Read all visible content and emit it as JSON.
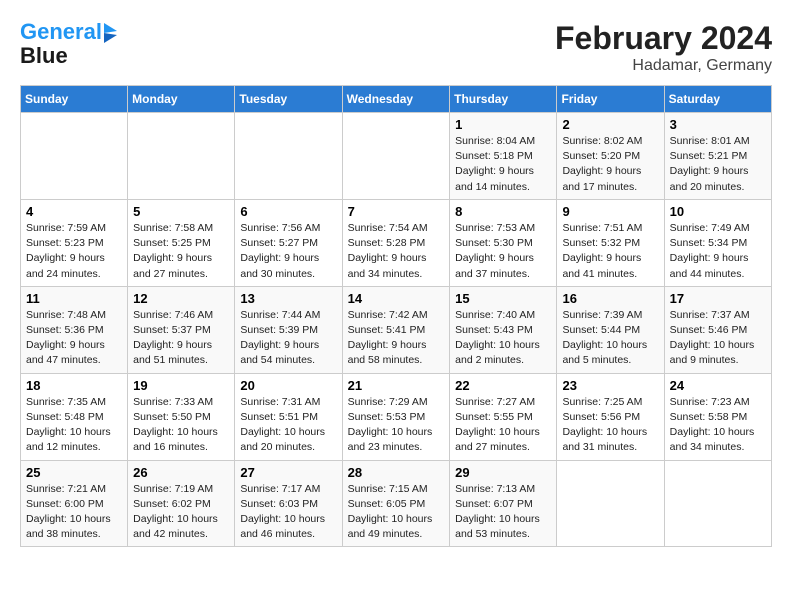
{
  "logo": {
    "line1": "General",
    "line2": "Blue"
  },
  "title": {
    "month_year": "February 2024",
    "location": "Hadamar, Germany"
  },
  "headers": [
    "Sunday",
    "Monday",
    "Tuesday",
    "Wednesday",
    "Thursday",
    "Friday",
    "Saturday"
  ],
  "weeks": [
    [
      {
        "day": "",
        "info": ""
      },
      {
        "day": "",
        "info": ""
      },
      {
        "day": "",
        "info": ""
      },
      {
        "day": "",
        "info": ""
      },
      {
        "day": "1",
        "info": "Sunrise: 8:04 AM\nSunset: 5:18 PM\nDaylight: 9 hours\nand 14 minutes."
      },
      {
        "day": "2",
        "info": "Sunrise: 8:02 AM\nSunset: 5:20 PM\nDaylight: 9 hours\nand 17 minutes."
      },
      {
        "day": "3",
        "info": "Sunrise: 8:01 AM\nSunset: 5:21 PM\nDaylight: 9 hours\nand 20 minutes."
      }
    ],
    [
      {
        "day": "4",
        "info": "Sunrise: 7:59 AM\nSunset: 5:23 PM\nDaylight: 9 hours\nand 24 minutes."
      },
      {
        "day": "5",
        "info": "Sunrise: 7:58 AM\nSunset: 5:25 PM\nDaylight: 9 hours\nand 27 minutes."
      },
      {
        "day": "6",
        "info": "Sunrise: 7:56 AM\nSunset: 5:27 PM\nDaylight: 9 hours\nand 30 minutes."
      },
      {
        "day": "7",
        "info": "Sunrise: 7:54 AM\nSunset: 5:28 PM\nDaylight: 9 hours\nand 34 minutes."
      },
      {
        "day": "8",
        "info": "Sunrise: 7:53 AM\nSunset: 5:30 PM\nDaylight: 9 hours\nand 37 minutes."
      },
      {
        "day": "9",
        "info": "Sunrise: 7:51 AM\nSunset: 5:32 PM\nDaylight: 9 hours\nand 41 minutes."
      },
      {
        "day": "10",
        "info": "Sunrise: 7:49 AM\nSunset: 5:34 PM\nDaylight: 9 hours\nand 44 minutes."
      }
    ],
    [
      {
        "day": "11",
        "info": "Sunrise: 7:48 AM\nSunset: 5:36 PM\nDaylight: 9 hours\nand 47 minutes."
      },
      {
        "day": "12",
        "info": "Sunrise: 7:46 AM\nSunset: 5:37 PM\nDaylight: 9 hours\nand 51 minutes."
      },
      {
        "day": "13",
        "info": "Sunrise: 7:44 AM\nSunset: 5:39 PM\nDaylight: 9 hours\nand 54 minutes."
      },
      {
        "day": "14",
        "info": "Sunrise: 7:42 AM\nSunset: 5:41 PM\nDaylight: 9 hours\nand 58 minutes."
      },
      {
        "day": "15",
        "info": "Sunrise: 7:40 AM\nSunset: 5:43 PM\nDaylight: 10 hours\nand 2 minutes."
      },
      {
        "day": "16",
        "info": "Sunrise: 7:39 AM\nSunset: 5:44 PM\nDaylight: 10 hours\nand 5 minutes."
      },
      {
        "day": "17",
        "info": "Sunrise: 7:37 AM\nSunset: 5:46 PM\nDaylight: 10 hours\nand 9 minutes."
      }
    ],
    [
      {
        "day": "18",
        "info": "Sunrise: 7:35 AM\nSunset: 5:48 PM\nDaylight: 10 hours\nand 12 minutes."
      },
      {
        "day": "19",
        "info": "Sunrise: 7:33 AM\nSunset: 5:50 PM\nDaylight: 10 hours\nand 16 minutes."
      },
      {
        "day": "20",
        "info": "Sunrise: 7:31 AM\nSunset: 5:51 PM\nDaylight: 10 hours\nand 20 minutes."
      },
      {
        "day": "21",
        "info": "Sunrise: 7:29 AM\nSunset: 5:53 PM\nDaylight: 10 hours\nand 23 minutes."
      },
      {
        "day": "22",
        "info": "Sunrise: 7:27 AM\nSunset: 5:55 PM\nDaylight: 10 hours\nand 27 minutes."
      },
      {
        "day": "23",
        "info": "Sunrise: 7:25 AM\nSunset: 5:56 PM\nDaylight: 10 hours\nand 31 minutes."
      },
      {
        "day": "24",
        "info": "Sunrise: 7:23 AM\nSunset: 5:58 PM\nDaylight: 10 hours\nand 34 minutes."
      }
    ],
    [
      {
        "day": "25",
        "info": "Sunrise: 7:21 AM\nSunset: 6:00 PM\nDaylight: 10 hours\nand 38 minutes."
      },
      {
        "day": "26",
        "info": "Sunrise: 7:19 AM\nSunset: 6:02 PM\nDaylight: 10 hours\nand 42 minutes."
      },
      {
        "day": "27",
        "info": "Sunrise: 7:17 AM\nSunset: 6:03 PM\nDaylight: 10 hours\nand 46 minutes."
      },
      {
        "day": "28",
        "info": "Sunrise: 7:15 AM\nSunset: 6:05 PM\nDaylight: 10 hours\nand 49 minutes."
      },
      {
        "day": "29",
        "info": "Sunrise: 7:13 AM\nSunset: 6:07 PM\nDaylight: 10 hours\nand 53 minutes."
      },
      {
        "day": "",
        "info": ""
      },
      {
        "day": "",
        "info": ""
      }
    ]
  ]
}
